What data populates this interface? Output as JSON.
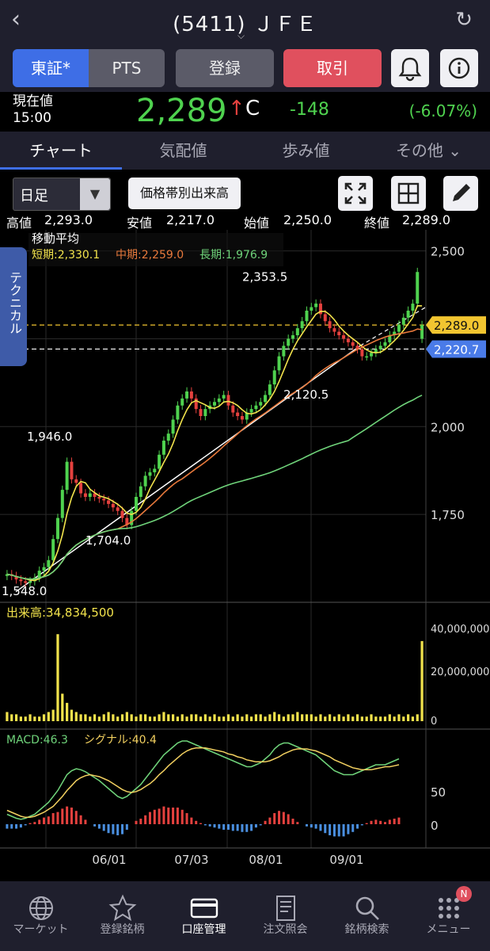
{
  "header": {
    "title": "(5411) ＪＦＥ",
    "back_icon": "chevron-left-icon",
    "reload_icon": "refresh-icon"
  },
  "buttons": {
    "tse": "東証*",
    "pts": "PTS",
    "register": "登録",
    "trade": "取引",
    "bell_icon": "bell-icon",
    "info_icon": "info-icon"
  },
  "price": {
    "label_line1": "現在値",
    "label_line2": "15:00",
    "value": "2,289",
    "arrow": "↑",
    "flag": "C",
    "change": "-148",
    "change_pct": "(-6.07%)"
  },
  "tabs": [
    {
      "label": "チャート"
    },
    {
      "label": "気配値"
    },
    {
      "label": "歩み値"
    },
    {
      "label": "その他 ⌄"
    }
  ],
  "controls": {
    "period": "日足",
    "volume_by_price": "価格帯別出来高",
    "expand_icon": "expand-icon",
    "grid_icon": "grid-icon",
    "pencil_icon": "pencil-icon"
  },
  "ohlc": {
    "high_label": "高値",
    "high": "2,293.0",
    "low_label": "安値",
    "low": "2,217.0",
    "open_label": "始値",
    "open": "2,250.0",
    "close_label": "終値",
    "close": "2,289.0"
  },
  "technical_tab": "テクニカル",
  "ma": {
    "title": "移動平均",
    "short": "短期:2,330.1",
    "mid": "中期:2,259.0",
    "long": "長期:1,976.9"
  },
  "volume_label": "出来高:34,834,500",
  "macd_label": "MACD:46.3",
  "signal_label": "シグナル:40.4",
  "price_axis": [
    "2,500",
    "2,000",
    "1,750"
  ],
  "volume_axis": [
    "40,000,000",
    "20,000,000",
    "0"
  ],
  "macd_axis": [
    "50",
    "0"
  ],
  "x_axis": [
    "06/01",
    "07/03",
    "08/01",
    "09/01"
  ],
  "price_tags": {
    "close": "2,289.0",
    "line2": "2,220.7"
  },
  "annotations": [
    "2,353.5",
    "2,120.5",
    "1,946.0",
    "1,704.0",
    "1,548.0"
  ],
  "colors": {
    "up": "#4fd24f",
    "down": "#e5413e",
    "accent": "#3e6ee6",
    "ma_short": "#f2e34c",
    "ma_mid": "#e8793c",
    "ma_long": "#6fd37a",
    "volume": "#f2e34c"
  },
  "nav": [
    {
      "label": "マーケット",
      "icon": "globe-icon"
    },
    {
      "label": "登録銘柄",
      "icon": "star-icon"
    },
    {
      "label": "口座管理",
      "icon": "card-icon"
    },
    {
      "label": "注文照会",
      "icon": "document-icon"
    },
    {
      "label": "銘柄検索",
      "icon": "search-icon"
    },
    {
      "label": "メニュー",
      "icon": "menu-grid-icon",
      "badge": "N"
    }
  ],
  "chart_data": {
    "type": "candlestick",
    "ylim": [
      1500,
      2560
    ],
    "closes": [
      1580,
      1575,
      1565,
      1560,
      1555,
      1560,
      1570,
      1590,
      1600,
      1620,
      1680,
      1740,
      1820,
      1900,
      1850,
      1840,
      1810,
      1800,
      1810,
      1800,
      1795,
      1790,
      1780,
      1770,
      1760,
      1740,
      1720,
      1760,
      1800,
      1830,
      1860,
      1870,
      1880,
      1920,
      1960,
      1980,
      2020,
      2060,
      2080,
      2100,
      2080,
      2050,
      2030,
      2050,
      2060,
      2070,
      2080,
      2090,
      2060,
      2040,
      2030,
      2020,
      2040,
      2050,
      2060,
      2070,
      2090,
      2120,
      2160,
      2200,
      2230,
      2250,
      2260,
      2280,
      2300,
      2330,
      2340,
      2350,
      2320,
      2300,
      2280,
      2270,
      2260,
      2250,
      2240,
      2230,
      2220,
      2200,
      2200,
      2210,
      2220,
      2230,
      2240,
      2260,
      2270,
      2290,
      2310,
      2330,
      2350,
      2440,
      2289
    ],
    "volume_m": [
      4,
      3,
      3,
      2,
      2,
      3,
      2,
      2,
      3,
      4,
      5,
      38,
      12,
      8,
      5,
      4,
      3,
      3,
      2,
      3,
      2,
      3,
      4,
      3,
      2,
      3,
      4,
      3,
      2,
      3,
      3,
      2,
      2,
      3,
      4,
      3,
      3,
      2,
      3,
      2,
      3,
      3,
      2,
      3,
      2,
      3,
      2,
      2,
      3,
      2,
      3,
      2,
      3,
      2,
      3,
      3,
      2,
      3,
      4,
      3,
      2,
      3,
      3,
      4,
      3,
      3,
      3,
      2,
      3,
      2,
      3,
      2,
      3,
      2,
      3,
      2,
      3,
      2,
      2,
      3,
      2,
      2,
      2,
      3,
      2,
      3,
      2,
      3,
      2,
      3,
      35
    ],
    "macd": [
      -10,
      -12,
      -14,
      -15,
      -14,
      -12,
      -10,
      -6,
      -2,
      2,
      8,
      14,
      22,
      30,
      34,
      36,
      35,
      33,
      30,
      27,
      24,
      20,
      16,
      12,
      8,
      6,
      8,
      12,
      16,
      20,
      26,
      32,
      38,
      44,
      50,
      54,
      58,
      62,
      64,
      64,
      62,
      60,
      58,
      56,
      54,
      52,
      50,
      48,
      46,
      44,
      42,
      40,
      38,
      38,
      40,
      42,
      46,
      50,
      56,
      60,
      62,
      62,
      60,
      58,
      56,
      54,
      52,
      50,
      46,
      42,
      38,
      34,
      32,
      30,
      30,
      30,
      32,
      34,
      36,
      38,
      40,
      40,
      40,
      42,
      44,
      46
    ],
    "signal": [
      -6,
      -8,
      -10,
      -12,
      -13,
      -13,
      -12,
      -10,
      -8,
      -5,
      -2,
      3,
      8,
      14,
      19,
      24,
      27,
      29,
      30,
      29,
      28,
      26,
      24,
      21,
      18,
      15,
      13,
      12,
      13,
      15,
      18,
      21,
      25,
      30,
      34,
      39,
      43,
      47,
      51,
      54,
      56,
      57,
      57,
      57,
      56,
      55,
      54,
      53,
      51,
      50,
      48,
      47,
      45,
      44,
      43,
      43,
      43,
      44,
      46,
      48,
      51,
      53,
      55,
      56,
      56,
      56,
      55,
      54,
      52,
      50,
      48,
      45,
      43,
      41,
      39,
      37,
      36,
      35,
      35,
      35,
      36,
      37,
      38,
      38,
      39,
      40
    ]
  }
}
